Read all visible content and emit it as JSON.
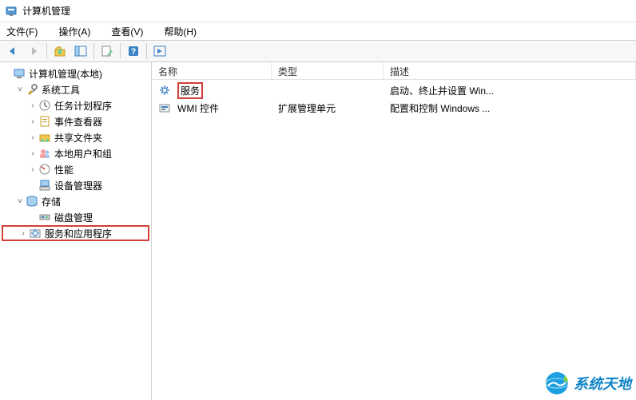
{
  "titlebar": {
    "title": "计算机管理"
  },
  "menubar": {
    "file": "文件(F)",
    "action": "操作(A)",
    "view": "查看(V)",
    "help": "帮助(H)"
  },
  "tree": {
    "root": "计算机管理(本地)",
    "system_tools": "系统工具",
    "task_scheduler": "任务计划程序",
    "event_viewer": "事件查看器",
    "shared_folders": "共享文件夹",
    "local_users": "本地用户和组",
    "performance": "性能",
    "device_manager": "设备管理器",
    "storage": "存储",
    "disk_management": "磁盘管理",
    "services_apps": "服务和应用程序"
  },
  "list": {
    "columns": {
      "name": "名称",
      "type": "类型",
      "desc": "描述"
    },
    "rows": [
      {
        "name": "服务",
        "type": "",
        "desc": "启动、终止并设置 Win...",
        "icon": "gear",
        "highlight": true
      },
      {
        "name": "WMI 控件",
        "type": "扩展管理单元",
        "desc": "配置和控制 Windows ...",
        "icon": "wmi",
        "highlight": false
      }
    ]
  },
  "watermark": {
    "text": "系统天地"
  }
}
